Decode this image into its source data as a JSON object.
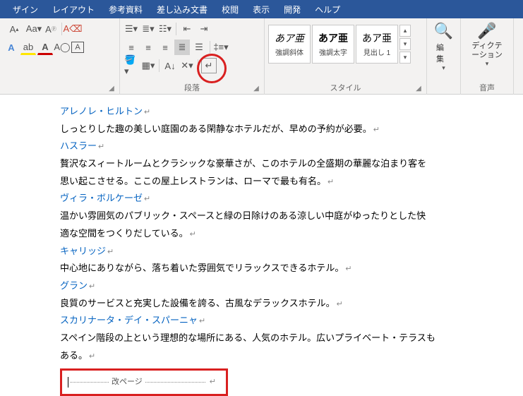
{
  "tabs": [
    "ザイン",
    "レイアウト",
    "参考資料",
    "差し込み文書",
    "校閲",
    "表示",
    "開発",
    "ヘルプ"
  ],
  "group_labels": {
    "font": "",
    "paragraph": "段落",
    "styles": "スタイル",
    "editing": "編集",
    "voice": "音声"
  },
  "styles": [
    {
      "preview": "あア亜",
      "name": "強調斜体",
      "italic": true
    },
    {
      "preview": "あア亜",
      "name": "強調太字",
      "bold": true
    },
    {
      "preview": "あア亜",
      "name": "見出し 1"
    }
  ],
  "editing_btn": "編集",
  "dictation_btn": "ディクテ\nーション",
  "document": {
    "p0": "アレノレ・ヒルトン",
    "p1": "しっとりした趣の美しい庭園のある閑静なホテルだが、早めの予約が必要。",
    "p2": "ハスラー",
    "p3a": "贅沢なスィートルームとクラシックな豪華さが、このホテルの全盛期の華麗な泊まり客を",
    "p3b": "思い起こさせる。ここの屋上レストランは、ローマで最も有名。",
    "p4": "ヴィラ・ボルケーゼ",
    "p5a": "温かい雰囲気のパブリック・スペースと緑の日除けのある涼しい中庭がゆったりとした快",
    "p5b": "適な空間をつくりだしている。",
    "p6": "キャリッジ",
    "p7": "中心地にありながら、落ち着いた雰囲気でリラックスできるホテル。",
    "p8": "グラン",
    "p9": "良質のサービスと充実した設備を誇る、古風なデラックスホテル。",
    "p10": "スカリナータ・デイ・スパーニャ",
    "p11a": "スペイン階段の上という理想的な場所にある、人気のホテル。広いプライベート・テラスも",
    "p11b": "ある。",
    "page_break": "改ページ"
  }
}
